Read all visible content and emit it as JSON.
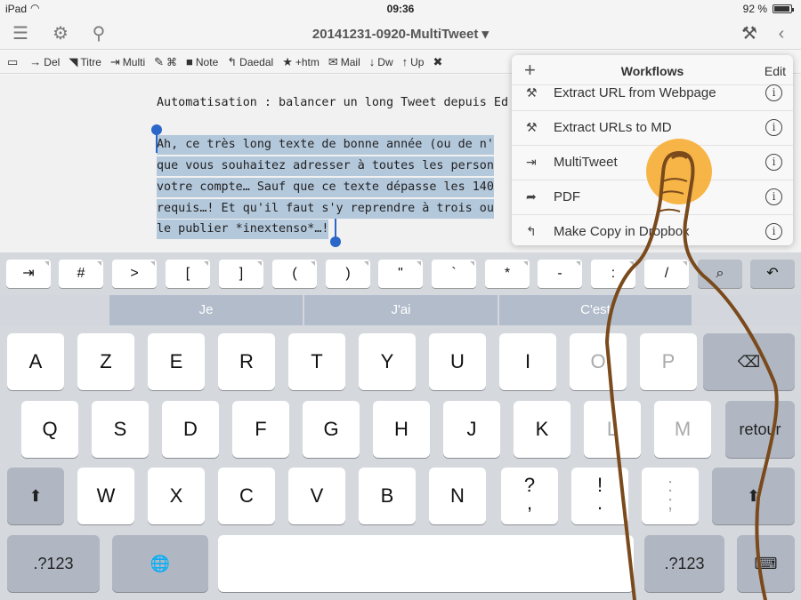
{
  "status": {
    "device": "iPad",
    "time": "09:36",
    "battery": "92 %",
    "battery_level": 0.92
  },
  "nav": {
    "title": "20141231-0920-MultiTweet ▾"
  },
  "toolbar": {
    "items": [
      {
        "icon": "book-icon",
        "glyph": "▭",
        "label": ""
      },
      {
        "icon": "arrow-circle-icon",
        "glyph": "→",
        "label": "Del"
      },
      {
        "icon": "tag-icon",
        "glyph": "◥",
        "label": "Titre"
      },
      {
        "icon": "export-icon",
        "glyph": "⇥",
        "label": "Multi"
      },
      {
        "icon": "edit-icon",
        "glyph": "✎",
        "label": "⌘"
      },
      {
        "icon": "comment-icon",
        "glyph": "■",
        "label": "Note"
      },
      {
        "icon": "reply-icon",
        "glyph": "↰",
        "label": "Daedal"
      },
      {
        "icon": "pin-icon",
        "glyph": "★",
        "label": "+htm"
      },
      {
        "icon": "mail-icon",
        "glyph": "✉",
        "label": "Mail"
      },
      {
        "icon": "down-arrow-icon",
        "glyph": "↓",
        "label": "Dw"
      },
      {
        "icon": "up-arrow-icon",
        "glyph": "↑",
        "label": "Up"
      },
      {
        "icon": "cross-icon",
        "glyph": "✖",
        "label": ""
      }
    ]
  },
  "editor": {
    "line1": "Automatisation : balancer un long Tweet depuis Ed",
    "lines": [
      "Ah, ce très long texte de bonne année (ou de n'",
      "que vous souhaitez adresser à toutes les person",
      "votre compte… Sauf que ce texte dépasse les 140",
      "requis…! Et qu'il faut s'y reprendre à trois ou",
      "le publier *inextenso*…!"
    ]
  },
  "popover": {
    "title": "Workflows",
    "edit": "Edit",
    "rows": [
      {
        "icon": "wrench-icon",
        "glyph": "⚒",
        "label": "Extract URL from Webpage"
      },
      {
        "icon": "wrench-icon",
        "glyph": "⚒",
        "label": "Extract URLs to MD"
      },
      {
        "icon": "export-icon",
        "glyph": "⇥",
        "label": "MultiTweet"
      },
      {
        "icon": "share-icon",
        "glyph": "➦",
        "label": "PDF"
      },
      {
        "icon": "reply-icon",
        "glyph": "↰",
        "label": "Make Copy in Dropbox"
      }
    ]
  },
  "extra_keys": [
    "⇥",
    "#",
    ">",
    "[",
    "]",
    "(",
    ")",
    "\"",
    "`",
    "*",
    "-",
    ":",
    "/",
    "⌕",
    "↶"
  ],
  "suggestions": [
    "Je",
    "J'ai",
    "C'est"
  ],
  "keyboard": {
    "row1": [
      "A",
      "Z",
      "E",
      "R",
      "T",
      "Y",
      "U",
      "I",
      "O",
      "P"
    ],
    "row2": [
      "Q",
      "S",
      "D",
      "F",
      "G",
      "H",
      "J",
      "K",
      "L",
      "M"
    ],
    "row3": [
      "W",
      "X",
      "C",
      "V",
      "B",
      "N"
    ],
    "row3_punct": [
      [
        "?",
        ","
      ],
      [
        "!",
        "."
      ],
      [
        ":",
        ";"
      ]
    ],
    "return": "retour",
    "numbers": ".?123",
    "globe": "🌐",
    "shift": "⬆",
    "delete": "⌫"
  }
}
